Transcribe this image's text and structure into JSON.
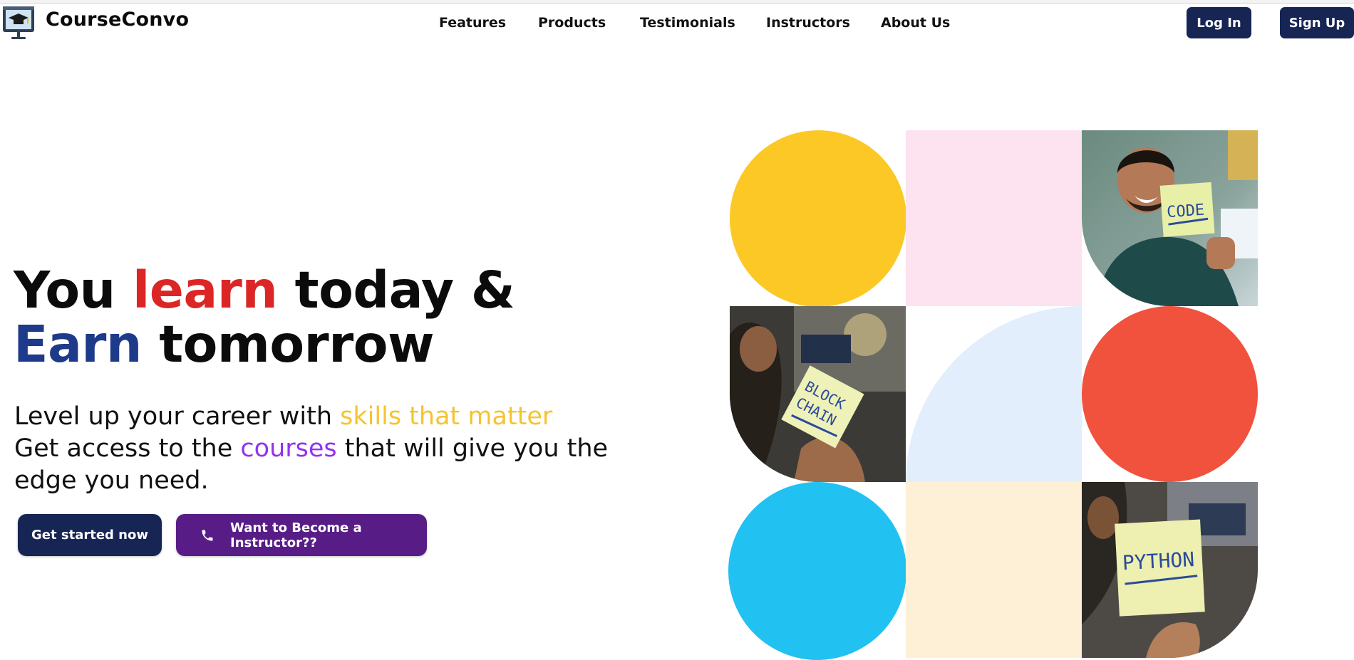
{
  "header": {
    "brand": "CourseConvo",
    "nav": [
      "Features",
      "Products",
      "Testimonials",
      "Instructors",
      "About Us"
    ],
    "login_label": "Log In",
    "signup_label": "Sign Up"
  },
  "hero": {
    "title_you": "You ",
    "title_learn": "learn",
    "title_today": " today &",
    "title_earn": "Earn",
    "title_tomorrow": " tomorrow",
    "sub_line1_a": "Level up your career with ",
    "sub_line1_b": "skills that matter",
    "sub_line2_a": "Get access to the ",
    "sub_line2_b": "courses",
    "sub_line2_c": " that will give you the edge you need.",
    "cta_primary": "Get started now",
    "cta_secondary": "Want to Become a Instructor??"
  },
  "tiles": {
    "note_code": "CODE",
    "note_blockchain_1": "BLOCK",
    "note_blockchain_2": "CHAIN",
    "note_python": "PYTHON"
  },
  "colors": {
    "navy": "#172554",
    "purple_button": "#581c87",
    "red_word": "#dc2626",
    "blue_word": "#1e3a8a",
    "yellow_text": "#f4c430",
    "purple_text": "#9333ea"
  },
  "icons": [
    "monitor-graduation-icon",
    "phone-icon"
  ]
}
